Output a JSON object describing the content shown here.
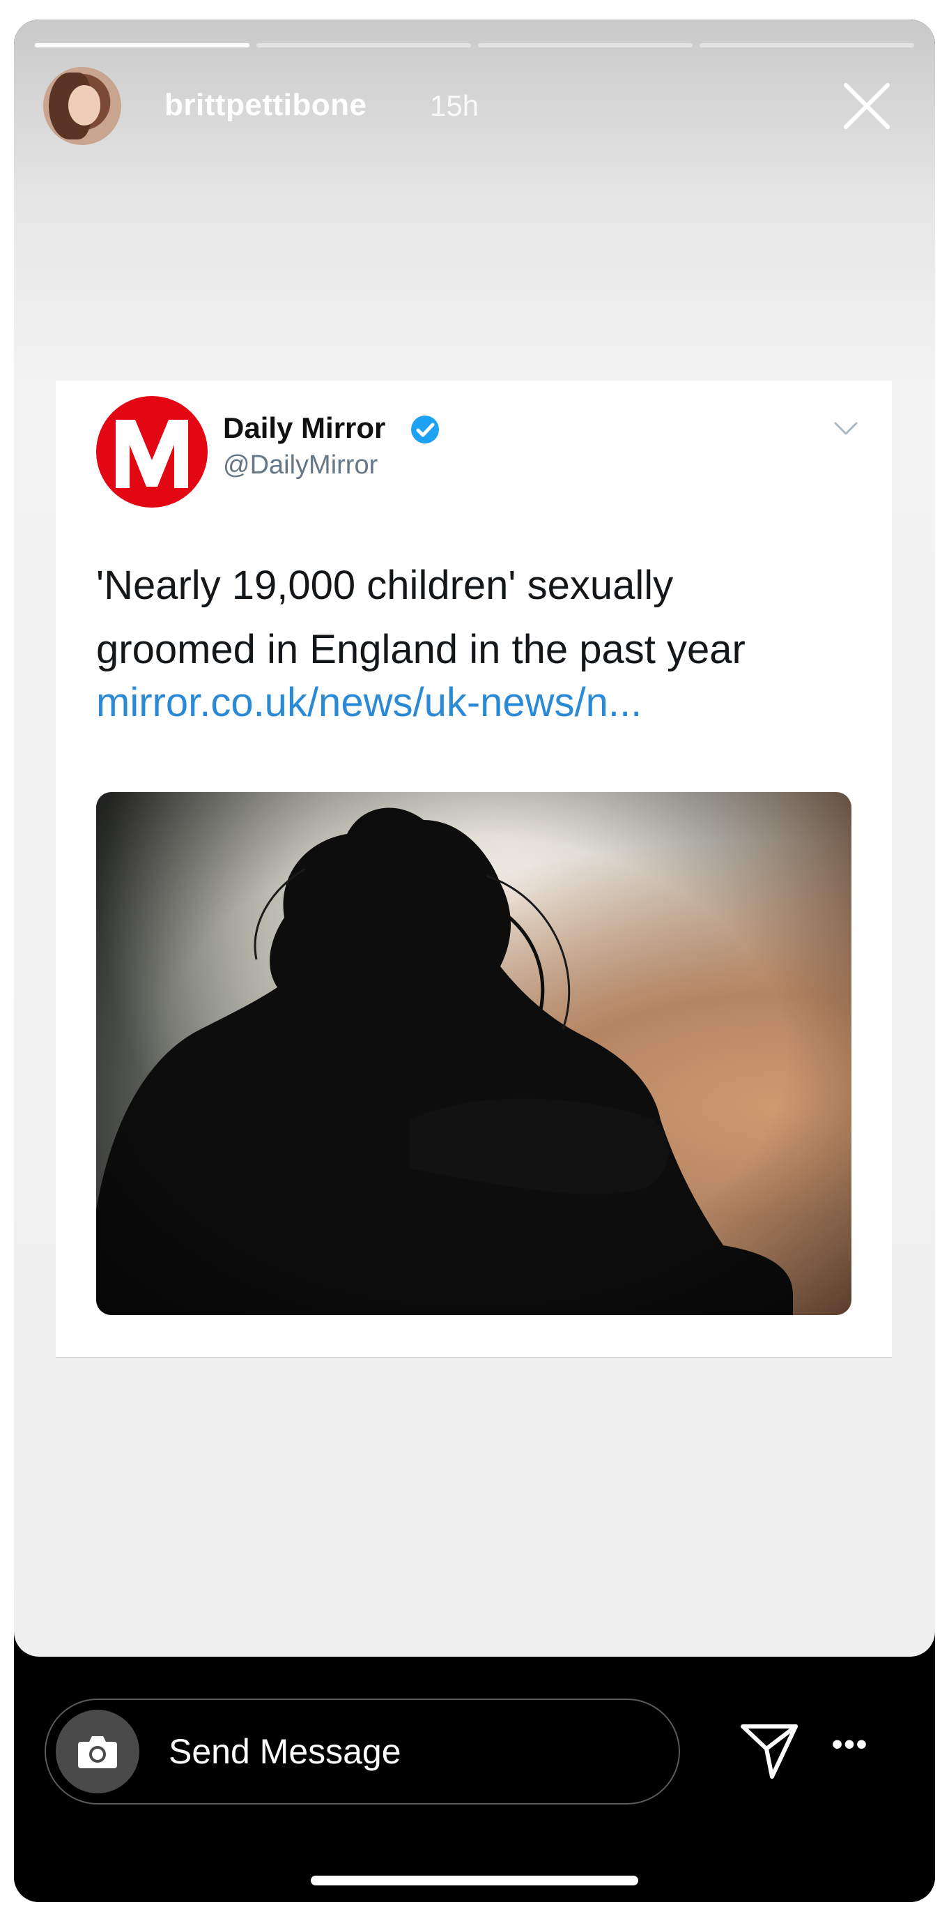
{
  "story": {
    "progress": [
      {
        "fill": 1.0
      },
      {
        "fill": 0.0
      },
      {
        "fill": 0.0
      },
      {
        "fill": 0.0
      }
    ],
    "username": "brittpettibone",
    "timestamp": "15h",
    "avatar_icon": "profile-photo",
    "close_icon": "close-icon"
  },
  "tweet": {
    "author_name": "Daily Mirror",
    "author_handle": "@DailyMirror",
    "verified": true,
    "logo_letter": "M",
    "logo_color": "#e30613",
    "text_lines": [
      "'Nearly 19,000 children' sexually",
      "groomed in England in the past year"
    ],
    "link": "mirror.co.uk/news/uk-news/n...",
    "link_color": "#2a8ad6",
    "chevron_icon": "chevron-down-icon",
    "image_icon": "silhouette-photo"
  },
  "bottom_bar": {
    "message_placeholder": "Send Message",
    "camera_icon": "camera-icon",
    "send_icon": "paper-plane-icon",
    "more_icon": "more-dots-icon",
    "more_label": "•••"
  }
}
